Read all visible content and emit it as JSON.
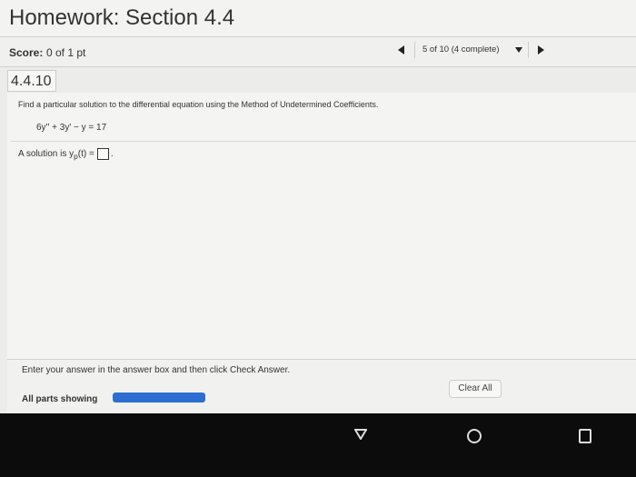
{
  "header": {
    "title": "Homework: Section 4.4"
  },
  "score": {
    "label": "Score:",
    "value": "0 of 1 pt"
  },
  "navigation": {
    "question_selector": "5 of 10 (4 complete)"
  },
  "problem": {
    "id": "4.4.10",
    "instruction": "Find a particular solution to the differential equation using the Method of Undetermined Coefficients.",
    "equation": "6y'' + 3y' − y = 17",
    "solution_prefix": "A solution is y",
    "solution_subscript": "p",
    "solution_suffix": "(t) =",
    "period": "."
  },
  "footer": {
    "hint": "Enter your answer in the answer box and then click Check Answer.",
    "parts_label": "All parts showing",
    "clear_label": "Clear All",
    "parts_progress": 1
  }
}
